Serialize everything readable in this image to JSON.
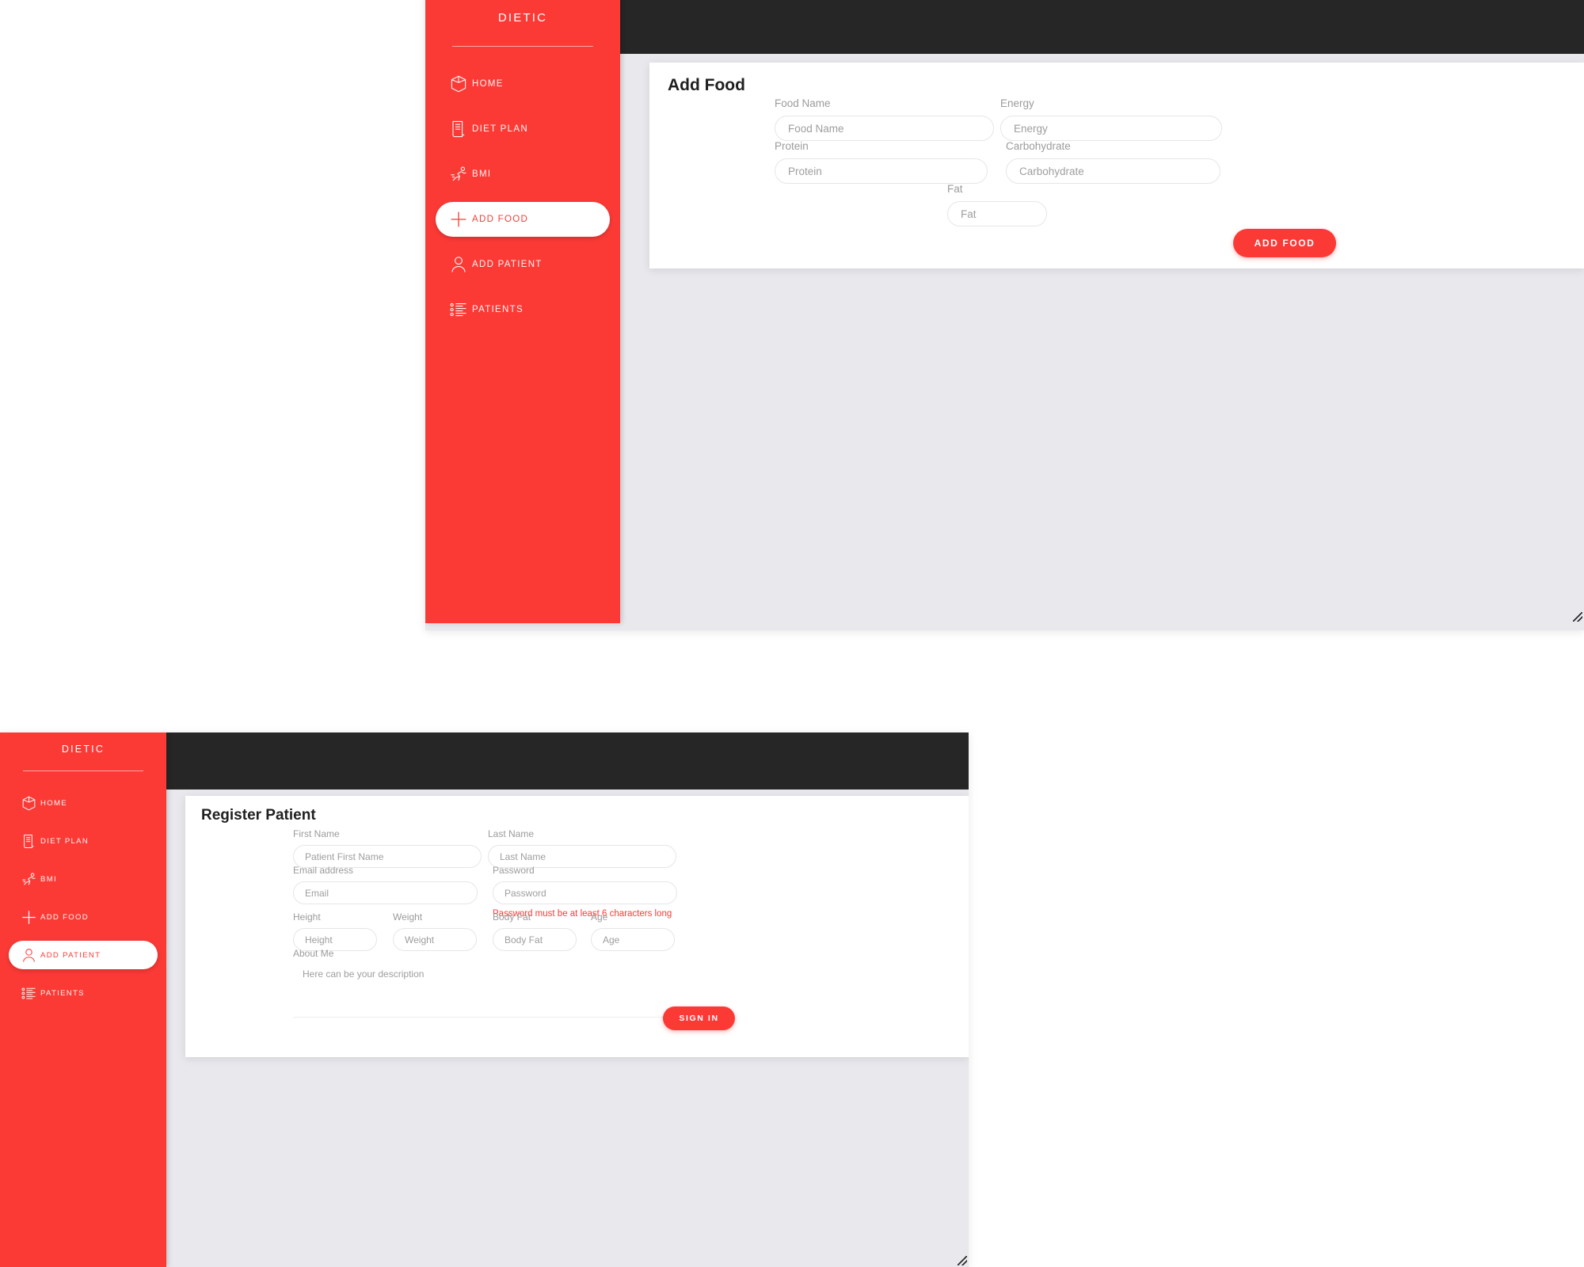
{
  "app": {
    "brand": "DIETIC",
    "accent_color": "#FB3A36",
    "header_color": "#262626",
    "page_background": "#E8E8ED",
    "card_background": "#FFFFFF"
  },
  "nav": {
    "items": [
      {
        "label": "HOME",
        "icon": "cube-icon"
      },
      {
        "label": "DIET PLAN",
        "icon": "document-icon"
      },
      {
        "label": "BMI",
        "icon": "running-person-icon"
      },
      {
        "label": "ADD FOOD",
        "icon": "plus-icon"
      },
      {
        "label": "ADD PATIENT",
        "icon": "user-icon"
      },
      {
        "label": "PATIENTS",
        "icon": "list-icon"
      }
    ]
  },
  "window_food": {
    "active_nav": "ADD FOOD",
    "topbar": {
      "account_icon": "user-icon",
      "caret_icon": "chevron-down-icon"
    },
    "card": {
      "title": "Add Food",
      "fields": [
        {
          "label": "Food Name",
          "placeholder": "Food Name",
          "value": ""
        },
        {
          "label": "Energy",
          "placeholder": "Energy",
          "value": ""
        },
        {
          "label": "Protein",
          "placeholder": "Protein",
          "value": ""
        },
        {
          "label": "Carbohydrate",
          "placeholder": "Carbohydrate",
          "value": ""
        },
        {
          "label": "Fat",
          "placeholder": "Fat",
          "value": ""
        }
      ],
      "submit_label": "ADD FOOD"
    }
  },
  "window_patient": {
    "active_nav": "ADD PATIENT",
    "topbar": {
      "account_icon": "user-icon",
      "caret_icon": "chevron-down-icon"
    },
    "card": {
      "title": "Register Patient",
      "fields": [
        {
          "label": "First Name",
          "placeholder": "Patient First Name",
          "value": ""
        },
        {
          "label": "Last Name",
          "placeholder": "Last Name",
          "value": ""
        },
        {
          "label": "Email address",
          "placeholder": "Email",
          "value": ""
        },
        {
          "label": "Password",
          "placeholder": "Password",
          "value": ""
        },
        {
          "label": "Height",
          "placeholder": "Height",
          "value": ""
        },
        {
          "label": "Weight",
          "placeholder": "Weight",
          "value": ""
        },
        {
          "label": "Body Fat",
          "placeholder": "Body Fat",
          "value": ""
        },
        {
          "label": "Age",
          "placeholder": "Age",
          "value": ""
        }
      ],
      "password_error": "Password must be at least 6 characters long",
      "about_label": "About Me",
      "about_placeholder": "Here can be your description",
      "submit_label": "SIGN IN"
    }
  }
}
